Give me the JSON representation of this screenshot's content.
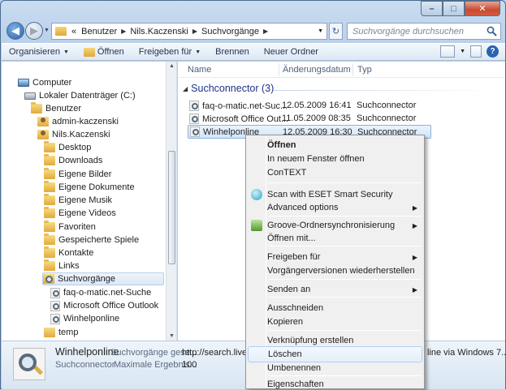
{
  "window": {
    "caption": {
      "min": "–",
      "max": "□",
      "close": "✕"
    }
  },
  "address": {
    "overflow": "«",
    "crumbs": [
      "Benutzer",
      "Nils.Kaczenski",
      "Suchvorgänge"
    ],
    "search_placeholder": "Suchvorgänge durchsuchen"
  },
  "toolbar": {
    "organize": "Organisieren",
    "open": "Öffnen",
    "share": "Freigeben für",
    "burn": "Brennen",
    "new_folder": "Neuer Ordner"
  },
  "tree": [
    {
      "label": "Computer",
      "icon": "computer-icon"
    },
    {
      "label": "Lokaler Datenträger (C:)",
      "icon": "drive-icon"
    },
    {
      "label": "Benutzer",
      "icon": "folder-icon"
    },
    {
      "label": "admin-kaczenski",
      "icon": "user-folder-icon"
    },
    {
      "label": "Nils.Kaczenski",
      "icon": "user-folder-icon"
    },
    {
      "label": "Desktop",
      "icon": "folder-icon"
    },
    {
      "label": "Downloads",
      "icon": "folder-icon"
    },
    {
      "label": "Eigene Bilder",
      "icon": "folder-icon"
    },
    {
      "label": "Eigene Dokumente",
      "icon": "folder-icon"
    },
    {
      "label": "Eigene Musik",
      "icon": "folder-icon"
    },
    {
      "label": "Eigene Videos",
      "icon": "folder-icon"
    },
    {
      "label": "Favoriten",
      "icon": "folder-icon"
    },
    {
      "label": "Gespeicherte Spiele",
      "icon": "folder-icon"
    },
    {
      "label": "Kontakte",
      "icon": "folder-icon"
    },
    {
      "label": "Links",
      "icon": "folder-icon"
    },
    {
      "label": "Suchvorgänge",
      "icon": "search-folder-icon"
    },
    {
      "label": "faq-o-matic.net-Suche",
      "icon": "search-connector-icon"
    },
    {
      "label": "Microsoft Office Outlook",
      "icon": "search-connector-icon"
    },
    {
      "label": "Winhelponline",
      "icon": "search-connector-icon"
    },
    {
      "label": "temp",
      "icon": "folder-icon"
    }
  ],
  "columns": {
    "name": "Name",
    "date": "Änderungsdatum",
    "type": "Typ"
  },
  "group": {
    "label": "Suchconnector (3)"
  },
  "files": [
    {
      "name": "faq-o-matic.net-Suc...",
      "date": "12.05.2009 16:41",
      "type": "Suchconnector"
    },
    {
      "name": "Microsoft Office Out...",
      "date": "11.05.2009 08:35",
      "type": "Suchconnector"
    },
    {
      "name": "Winhelponline",
      "date": "12.05.2009 16:30",
      "type": "Suchconnector"
    }
  ],
  "details": {
    "name": "Winhelponline",
    "type": "Suchconnector",
    "desc_label": "Suchvorgänge gese...",
    "url": "http://search.live.co...",
    "max_label": "Maximale Ergebnis...",
    "max_value": "100",
    "right_text": "line via Windows 7..."
  },
  "context_menu": {
    "open": "Öffnen",
    "open_new_window": "In neuem Fenster öffnen",
    "context": "ConTEXT",
    "eset_scan": "Scan with ESET Smart Security",
    "advanced": "Advanced options",
    "groove": "Groove-Ordnersynchronisierung",
    "open_with": "Öffnen mit...",
    "share": "Freigeben für",
    "restore": "Vorgängerversionen wiederherstellen",
    "send_to": "Senden an",
    "cut": "Ausschneiden",
    "copy": "Kopieren",
    "shortcut": "Verknüpfung erstellen",
    "delete": "Löschen",
    "rename": "Umbenennen",
    "properties": "Eigenschaften"
  }
}
